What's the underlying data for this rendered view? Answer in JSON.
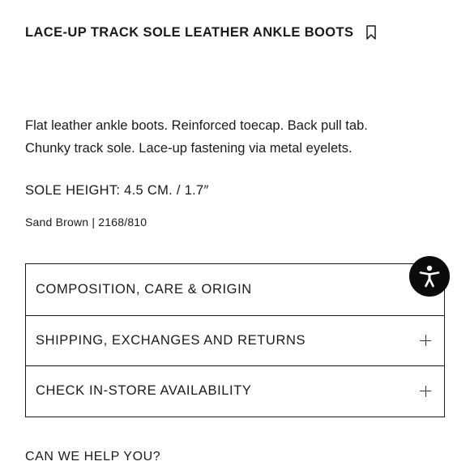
{
  "product": {
    "title": "LACE-UP TRACK SOLE LEATHER ANKLE BOOTS",
    "bookmark_icon": "bookmark-icon",
    "description_lines": [
      "Flat leather ankle boots. Reinforced toecap. Back pull tab.",
      "Chunky track sole. Lace-up fastening via metal eyelets."
    ],
    "sole_height": "SOLE HEIGHT: 4.5 CM. / 1.7″",
    "color_ref": "Sand Brown | 2168/810"
  },
  "accordion": {
    "items": [
      {
        "label": "COMPOSITION, CARE & ORIGIN",
        "icon": "plus-icon"
      },
      {
        "label": "SHIPPING, EXCHANGES AND RETURNS",
        "icon": "plus-icon"
      },
      {
        "label": "CHECK IN-STORE AVAILABILITY",
        "icon": "plus-icon"
      }
    ]
  },
  "help": {
    "label": "CAN WE HELP YOU?"
  },
  "accessibility_widget": {
    "icon": "accessibility-icon",
    "background": "#0b0b0b"
  }
}
